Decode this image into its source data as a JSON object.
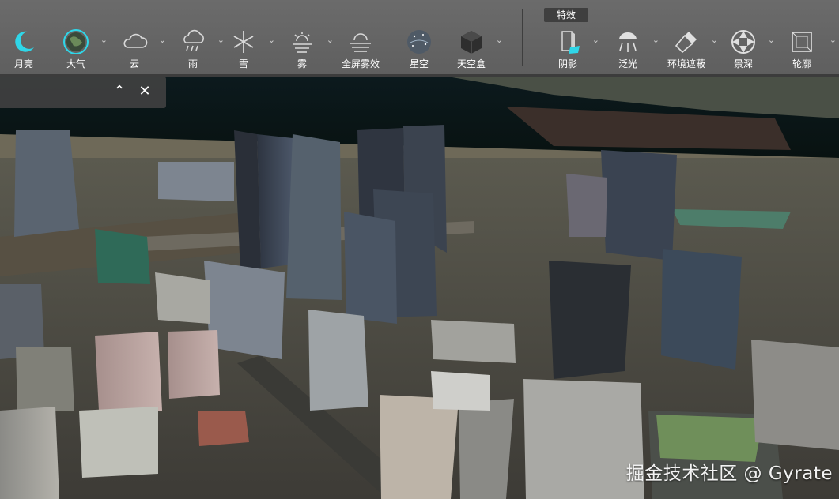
{
  "toolbar": {
    "tools": [
      {
        "id": "moon",
        "label": "月亮",
        "icon": "moon-icon",
        "active": true
      },
      {
        "id": "atmosphere",
        "label": "大气",
        "icon": "globe-atmosphere-icon",
        "active": true
      },
      {
        "id": "cloud",
        "label": "云",
        "icon": "cloud-icon"
      },
      {
        "id": "rain",
        "label": "雨",
        "icon": "rain-cloud-icon"
      },
      {
        "id": "snow",
        "label": "雪",
        "icon": "snowflake-icon"
      },
      {
        "id": "fog",
        "label": "雾",
        "icon": "fog-sun-icon"
      },
      {
        "id": "fullscreen_fog",
        "label": "全屏雾效",
        "icon": "fullscreen-fog-icon"
      },
      {
        "id": "starry_sky",
        "label": "星空",
        "icon": "starry-globe-icon"
      },
      {
        "id": "skybox",
        "label": "天空盒",
        "icon": "skybox-cube-icon"
      }
    ],
    "effects_label": "特效",
    "effects": [
      {
        "id": "shadow",
        "label": "阴影",
        "icon": "shadow-box-icon"
      },
      {
        "id": "floodlight",
        "label": "泛光",
        "icon": "floodlight-icon"
      },
      {
        "id": "ambient_occlusion",
        "label": "环境遮蔽",
        "icon": "flashlight-icon"
      },
      {
        "id": "depth_of_field",
        "label": "景深",
        "icon": "aperture-icon"
      },
      {
        "id": "outline",
        "label": "轮廓",
        "icon": "outline-cube-icon"
      }
    ],
    "accent_color": "#2fd6e8"
  },
  "panel": {
    "collapse_glyph": "⌃",
    "close_glyph": "✕"
  },
  "watermark": "掘金技术社区 @ Gyrate"
}
